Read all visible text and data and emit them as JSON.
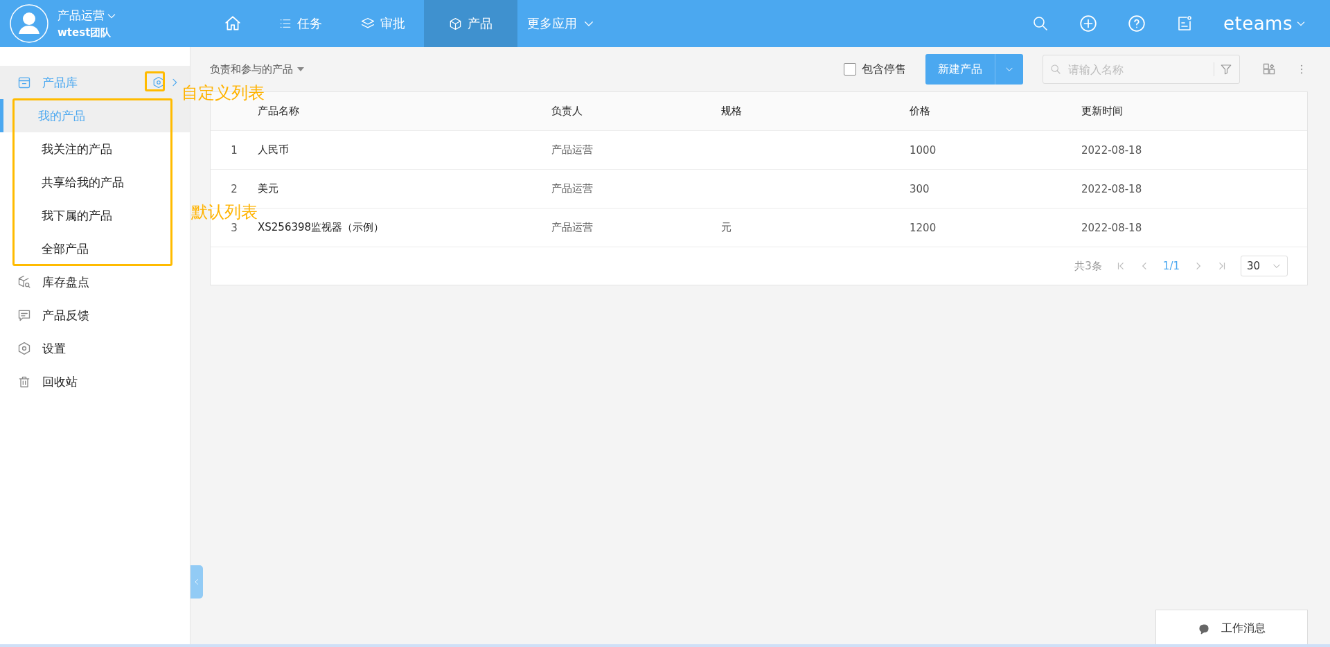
{
  "header": {
    "user": "产品运营",
    "team": "wtest团队",
    "brand": "eteams",
    "nav": [
      {
        "kind": "home",
        "selected": false
      },
      {
        "kind": "list",
        "label": "任务",
        "selected": false
      },
      {
        "kind": "layers",
        "label": "审批",
        "selected": false
      },
      {
        "kind": "cube",
        "label": "产品",
        "selected": true
      },
      {
        "kind": "more",
        "label": "更多应用",
        "selected": false
      }
    ]
  },
  "sidebar": {
    "items": [
      {
        "kind": "archive",
        "label": "产品库",
        "selected": false,
        "expanded": true,
        "children": [
          {
            "label": "我的产品",
            "selected": true
          },
          {
            "label": "我关注的产品",
            "selected": false
          },
          {
            "label": "共享给我的产品",
            "selected": false
          },
          {
            "label": "我下属的产品",
            "selected": false
          },
          {
            "label": "全部产品",
            "selected": false
          }
        ]
      },
      {
        "kind": "inventory",
        "label": "库存盘点",
        "selected": false
      },
      {
        "kind": "feedback",
        "label": "产品反馈",
        "selected": false
      },
      {
        "kind": "settings",
        "label": "设置",
        "selected": false
      },
      {
        "kind": "trash",
        "label": "回收站",
        "selected": false
      }
    ]
  },
  "annotations": {
    "custom": "自定义列表",
    "default": "默认列表"
  },
  "toolbar": {
    "scope": "负责和参与的产品",
    "include_stopped": {
      "label": "包含停售",
      "checked": false
    },
    "new_button": "新建产品",
    "search": {
      "placeholder": "请输入名称"
    }
  },
  "table": {
    "columns": [
      "",
      "产品名称",
      "负责人",
      "规格",
      "价格",
      "更新时间"
    ],
    "rows": [
      [
        "1",
        "人民币",
        "产品运营",
        "",
        "1000",
        "2022-08-18"
      ],
      [
        "2",
        "美元",
        "产品运营",
        "",
        "300",
        "2022-08-18"
      ],
      [
        "3",
        "XS256398监视器（示例）",
        "产品运营",
        "元",
        "1200",
        "2022-08-18"
      ]
    ]
  },
  "pagination": {
    "total": "共3条",
    "page": "1/1",
    "page_size": "30"
  },
  "chat": {
    "label": "工作消息"
  }
}
